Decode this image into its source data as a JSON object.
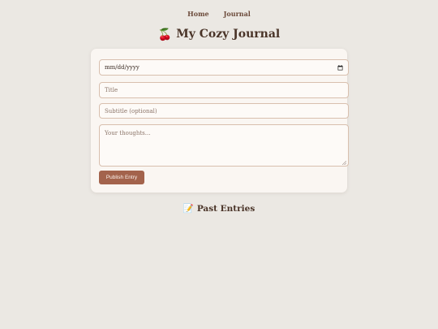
{
  "nav": {
    "items": [
      {
        "label": "Home"
      },
      {
        "label": "Journal"
      }
    ]
  },
  "header": {
    "icon": "cherry-icon",
    "icon_glyph": "🍒",
    "title": "My Cozy Journal"
  },
  "form": {
    "date_placeholder": "mm/dd/yyyy",
    "title_placeholder": "Title",
    "subtitle_placeholder": "Subtitle (optional)",
    "body_placeholder": "Your thoughts...",
    "publish_label": "Publish Entry"
  },
  "past_entries": {
    "icon": "memo-icon",
    "icon_glyph": "📝",
    "title": "Past Entries"
  },
  "colors": {
    "background": "#ebe8e3",
    "card": "#faf6f2",
    "accent": "#a3634c",
    "text": "#4a3428",
    "border": "#d8bfae"
  }
}
